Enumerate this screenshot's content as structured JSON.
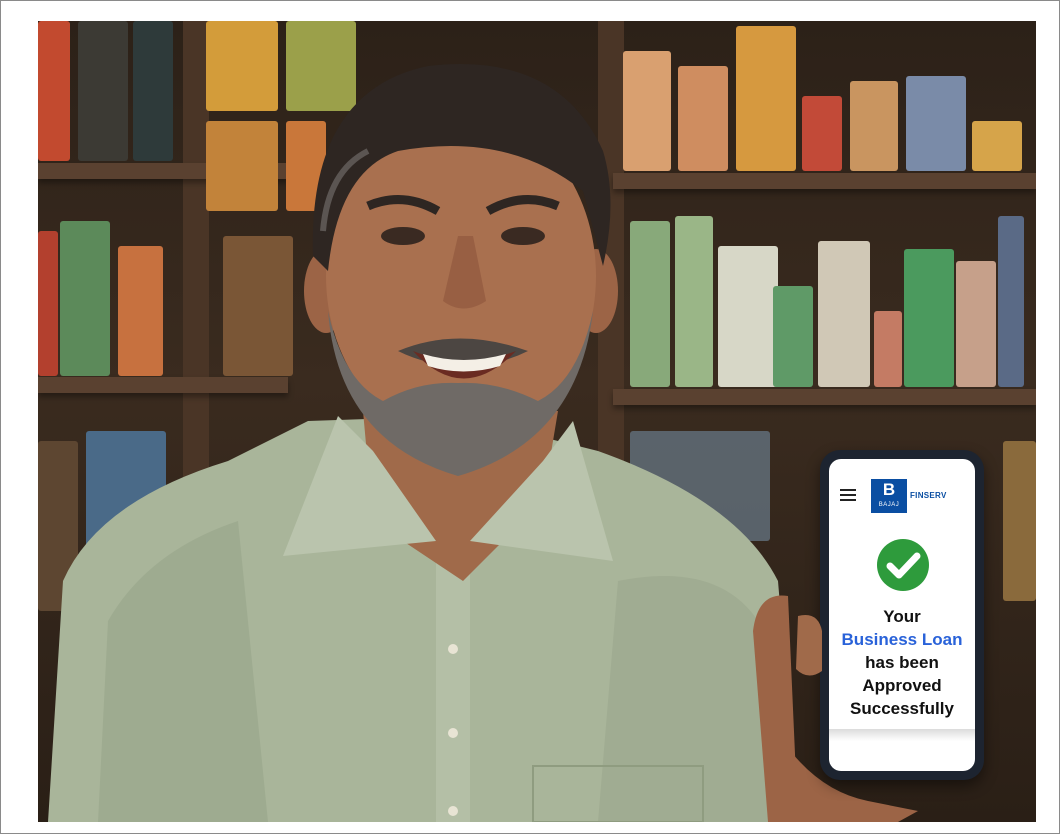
{
  "phone": {
    "logo_letter": "B",
    "logo_small": "BAJAJ",
    "logo_text": "FINSERV",
    "line1": "Your",
    "line2": "Business Loan",
    "line3": "has been",
    "line4": "Approved",
    "line5": "Successfully"
  },
  "colors": {
    "brand": "#0a4ea2",
    "highlight": "#2962d9",
    "check": "#2e9b3c",
    "shirt": "#a9b59a"
  },
  "icons": [
    "menu-icon",
    "check-circle-icon"
  ]
}
